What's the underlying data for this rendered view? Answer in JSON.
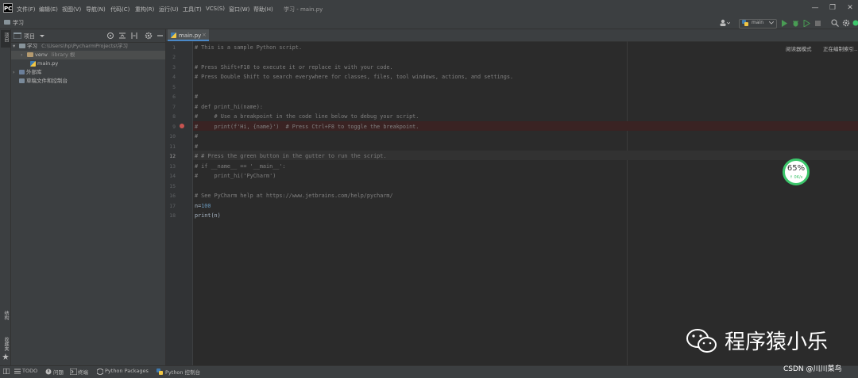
{
  "app": {
    "logo": "PC",
    "menu": [
      "文件(F)",
      "编辑(E)",
      "视图(V)",
      "导航(N)",
      "代码(C)",
      "重构(R)",
      "运行(U)",
      "工具(T)",
      "VCS(S)",
      "窗口(W)",
      "帮助(H)"
    ],
    "window_title": "学习 - main.py",
    "window_controls": [
      "—",
      "❐",
      "✕"
    ]
  },
  "navbar": {
    "breadcrumb": "学习",
    "branch": "main"
  },
  "left_stripe": {
    "top_label": "项目",
    "bottom_labels": [
      "结构",
      "收藏夹"
    ]
  },
  "project": {
    "header_label": "项目",
    "tree": [
      {
        "label": "学习",
        "hint": "C:\\Users\\hp\\PycharmProjects\\学习",
        "kind": "folder",
        "expanded": true
      },
      {
        "label": "venv",
        "hint": "library 根",
        "kind": "folder",
        "expanded": false,
        "selected": true
      },
      {
        "label": "main.py",
        "hint": "",
        "kind": "py"
      },
      {
        "label": "外部库",
        "hint": "",
        "kind": "lib"
      },
      {
        "label": "草稿文件和控制台",
        "hint": "",
        "kind": "scratch"
      }
    ]
  },
  "editor": {
    "tab_label": "main.py",
    "reader_mode": "阅读器模式",
    "indexing": "正在编制索引…",
    "line_numbers": [
      "1",
      "2",
      "3",
      "4",
      "5",
      "6",
      "7",
      "8",
      "9",
      "10",
      "11",
      "12",
      "13",
      "14",
      "15",
      "16",
      "17",
      "18"
    ],
    "lines": [
      "# This is a sample Python script.",
      "",
      "# Press Shift+F10 to execute it or replace it with your code.",
      "# Press Double Shift to search everywhere for classes, files, tool windows, actions, and settings.",
      "",
      "",
      "#",
      "# def print_hi(name):",
      "#     # Use a breakpoint in the code line below to debug your script.",
      "#     print(f'Hi, {name}')  # Press Ctrl+F8 to toggle the breakpoint.",
      "#",
      "#",
      "# # Press the green button in the gutter to run the script.",
      "# if __name__ == '__main__':",
      "#     print_hi('PyCharm')",
      "",
      "# See PyCharm help at https://www.jetbrains.com/help/pycharm/",
      "n=100",
      "print(n)"
    ],
    "code_n_var": "n=",
    "code_n_val": "100",
    "code_print": "print(n)"
  },
  "cpu_widget": {
    "value": "65%",
    "rate": "↑ 0K/s"
  },
  "statusbar": {
    "items": [
      "TODO",
      "问题",
      "终端",
      "Python Packages",
      "Python 控制台"
    ]
  },
  "watermark": {
    "text": "程序猿小乐",
    "credit": "CSDN @川川菜鸟"
  },
  "colors": {
    "accent": "#4a88c7",
    "breakpoint": "#c75450",
    "run_green": "#499c54",
    "cpu_green": "#3cc66b"
  }
}
